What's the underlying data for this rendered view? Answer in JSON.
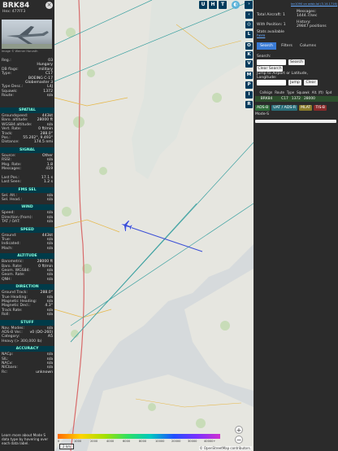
{
  "aircraft": {
    "callsign": "BRK84",
    "hex": "Hex:   477FF3",
    "photo_credit": "Image © Werner Horvath",
    "details": [
      {
        "k": "Reg.:",
        "v": "03"
      },
      {
        "k": "",
        "v": "Hungary"
      },
      {
        "k": "DB flags:",
        "v": "military"
      },
      {
        "k": "Type:",
        "v": "C17"
      },
      {
        "k": "",
        "v": "BOEING C-17"
      },
      {
        "k": "",
        "v": "Globemaster 3"
      },
      {
        "k": "Type Desc.:",
        "v": "L4J"
      },
      {
        "k": "Squawk:",
        "v": "1372"
      },
      {
        "k": "Route:",
        "v": "n/a"
      }
    ]
  },
  "sections": [
    {
      "title": "SPATIAL",
      "rows": [
        {
          "k": "Groundspeed:",
          "v": "443kt"
        },
        {
          "k": "Baro. altitude:",
          "v": "28000 ft"
        },
        {
          "k": "WGS84 altitude:",
          "v": "n/a"
        },
        {
          "k": "Vert. Rate:",
          "v": "0 ft/min"
        },
        {
          "k": "Track:",
          "v": "288.0°"
        },
        {
          "k": "Pos.:",
          "v": "55.202°, 9.493°"
        },
        {
          "k": "Distance:",
          "v": "174.5 nmi"
        }
      ]
    },
    {
      "title": "SIGNAL",
      "rows": [
        {
          "k": "Source:",
          "v": "Other"
        },
        {
          "k": "RSSI:",
          "v": "n/a"
        },
        {
          "k": "Msg. Rate:",
          "v": "1.8"
        },
        {
          "k": "Messages:",
          "v": "419"
        },
        {
          "k": "",
          "v": ""
        },
        {
          "k": "Last Pos.:",
          "v": "17.1 s"
        },
        {
          "k": "Last Seen:",
          "v": "1.2 s"
        }
      ]
    },
    {
      "title": "FMS SEL",
      "rows": [
        {
          "k": "Sel. Alt.:",
          "v": "n/a"
        },
        {
          "k": "Sel. Head.:",
          "v": "n/a"
        }
      ]
    },
    {
      "title": "WIND",
      "rows": [
        {
          "k": "Speed:",
          "v": "n/a"
        },
        {
          "k": "Direction (from):",
          "v": "n/a"
        },
        {
          "k": "TAT / OAT:",
          "v": "n/a"
        }
      ]
    },
    {
      "title": "SPEED",
      "rows": [
        {
          "k": "Ground:",
          "v": "443kt"
        },
        {
          "k": "True:",
          "v": "n/a"
        },
        {
          "k": "Indicated:",
          "v": "n/a"
        },
        {
          "k": "Mach:",
          "v": "n/a"
        }
      ]
    },
    {
      "title": "ALTITUDE",
      "rows": [
        {
          "k": "Barometric:",
          "v": "28000 ft"
        },
        {
          "k": "Baro. Rate:",
          "v": "0 ft/min"
        },
        {
          "k": "Geom. WGS84:",
          "v": "n/a"
        },
        {
          "k": "Geom. Rate:",
          "v": "n/a"
        },
        {
          "k": "QNH:",
          "v": "n/a"
        }
      ]
    },
    {
      "title": "DIRECTION",
      "rows": [
        {
          "k": "Ground Track:",
          "v": "288.0°"
        },
        {
          "k": "True Heading:",
          "v": "n/a"
        },
        {
          "k": "Magnetic Heading:",
          "v": "n/a"
        },
        {
          "k": "Magnetic Decl.:",
          "v": "4.3°"
        },
        {
          "k": "Track Rate:",
          "v": "n/a"
        },
        {
          "k": "Roll:",
          "v": "n/a"
        }
      ]
    },
    {
      "title": "STUFF",
      "rows": [
        {
          "k": "Nav. Modes:",
          "v": "n/a"
        },
        {
          "k": "ADS-B Ver.:",
          "v": "v0 (DO-260)"
        },
        {
          "k": "Category:",
          "v": "A5"
        },
        {
          "k": "Heavy (> 300,000 lb)",
          "v": ""
        }
      ]
    },
    {
      "title": "ACCURACY",
      "rows": [
        {
          "k": "NACp:",
          "v": "n/a"
        },
        {
          "k": "SIL:",
          "v": "n/a"
        },
        {
          "k": "NACv:",
          "v": "n/a"
        },
        {
          "k": "NICbaro:",
          "v": "n/a"
        },
        {
          "k": "Rc:",
          "v": "unknown"
        }
      ]
    }
  ],
  "footer_note": "Learn more about Mode S data type by hovering over each data label.",
  "map": {
    "top_buttons": [
      "U",
      "H",
      "T"
    ],
    "side_buttons": [
      "L",
      "O",
      "K",
      "V",
      "M",
      "P",
      "I",
      "R"
    ],
    "colorbar_labels": [
      "0",
      "1000",
      "2000",
      "4000",
      "6000",
      "8000",
      "10000",
      "20000",
      "30000",
      "40000+"
    ],
    "scale": "2 km",
    "zoom_in": "+",
    "zoom_out": "−",
    "attribution": "© OpenStreetMap contributors."
  },
  "right": {
    "link": "tar1090 on adsb.lol (3.14.1716)",
    "total_aircraft_label": "Total Aircraft:",
    "total_aircraft": "1",
    "with_positions_label": "With Position:",
    "with_positions": "1",
    "messages_label": "Messages:",
    "messages_rate": "1444.7/sec",
    "history_label": "History:",
    "history": "29847 positions",
    "stats": "Stats available",
    "stats_link": "here",
    "tabs": [
      "Search",
      "Filters",
      "Columns"
    ],
    "search_label": "Search:",
    "search_button": "Search",
    "clear_search": "Clear Search",
    "jump_label": "Jump to Airport or Latitude, Longitude:",
    "jump_button": "Jump",
    "clear_button": "Clear",
    "columns": [
      "",
      "Callsign",
      "Route",
      "Type",
      "Squawk",
      "Alt. (ft)",
      "Spd"
    ],
    "row": [
      "",
      "BRK84",
      "",
      "C17",
      "1372",
      "28000",
      ""
    ],
    "badges": [
      "ADS-B",
      "UAT / ADS-R",
      "MLAT",
      "TIS-B"
    ],
    "mode_s": "Mode-S"
  },
  "colors": {
    "accent": "#3a7bd5",
    "section": "#003b49",
    "map_btn": "#003b5c",
    "track": "#3b4fd6"
  }
}
